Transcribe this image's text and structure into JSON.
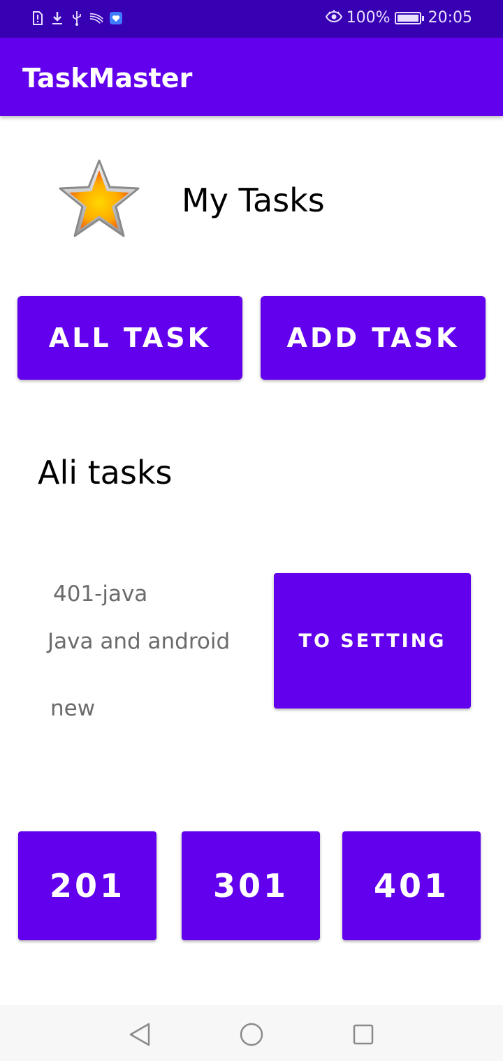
{
  "status_bar": {
    "battery": "100%",
    "time": "20:05",
    "icons": [
      "sim-alert-icon",
      "download-icon",
      "usb-icon",
      "swift-icon",
      "app-badge-icon"
    ],
    "right_icons": [
      "eye-comfort-icon",
      "battery-charging-icon"
    ]
  },
  "app_bar": {
    "title": "TaskMaster"
  },
  "header": {
    "icon": "star-icon",
    "title": "My Tasks"
  },
  "actions": {
    "all_task": "ALL TASK",
    "add_task": "ADD TASK"
  },
  "section": {
    "title": "Ali tasks"
  },
  "task": {
    "title": "401-java",
    "body": "Java and android",
    "state": "new"
  },
  "settings_button": "TO SETTING",
  "quick_buttons": [
    "201",
    "301",
    "401"
  ],
  "nav": [
    "back-icon",
    "home-icon",
    "recents-icon"
  ],
  "colors": {
    "primary": "#6200ee",
    "primary_dark": "#3700b3",
    "secondary_text": "#6b6b6b"
  }
}
